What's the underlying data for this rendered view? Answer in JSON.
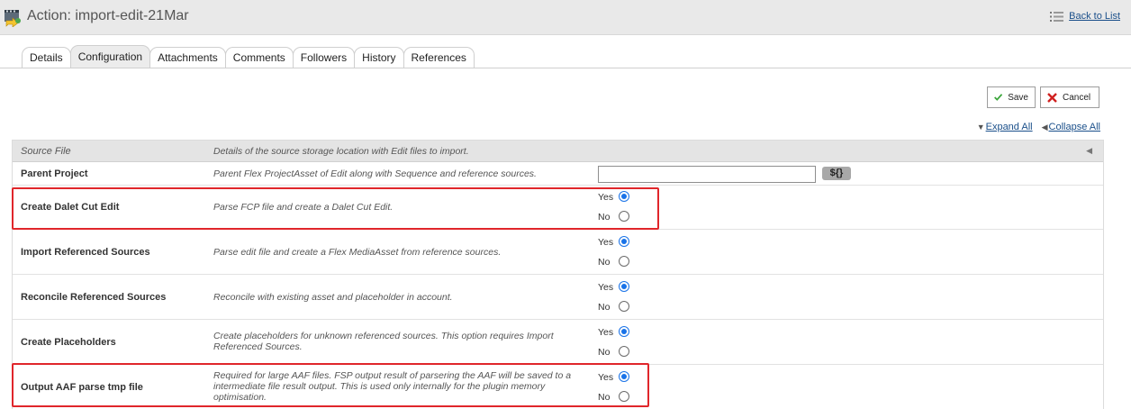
{
  "header": {
    "title": "Action: import-edit-21Mar",
    "back_label": "Back to List"
  },
  "tabs": [
    {
      "label": "Details"
    },
    {
      "label": "Configuration",
      "active": true
    },
    {
      "label": "Attachments"
    },
    {
      "label": "Comments"
    },
    {
      "label": "Followers"
    },
    {
      "label": "History"
    },
    {
      "label": "References"
    }
  ],
  "toolbar": {
    "save_label": "Save",
    "cancel_label": "Cancel"
  },
  "links": {
    "expand_all": "Expand All",
    "collapse_all": "Collapse All"
  },
  "section": {
    "label": "Source File",
    "description": "Details of the source storage location with Edit files to import."
  },
  "rows": {
    "parent_project": {
      "label": "Parent Project",
      "description": "Parent Flex ProjectAsset of Edit along with Sequence and reference sources.",
      "value": "",
      "var_button": "${}"
    },
    "create_dalet": {
      "label": "Create Dalet Cut Edit",
      "description": "Parse FCP file and create a Dalet Cut Edit.",
      "yes": "Yes",
      "no": "No",
      "selected": "Yes"
    },
    "import_sources": {
      "label": "Import Referenced Sources",
      "description": "Parse edit file and create a Flex MediaAsset from reference sources.",
      "yes": "Yes",
      "no": "No",
      "selected": "Yes"
    },
    "reconcile": {
      "label": "Reconcile Referenced Sources",
      "description": "Reconcile with existing asset and placeholder in account.",
      "yes": "Yes",
      "no": "No",
      "selected": "Yes"
    },
    "placeholders": {
      "label": "Create Placeholders",
      "description": "Create placeholders for unknown referenced sources. This option requires Import Referenced Sources.",
      "yes": "Yes",
      "no": "No",
      "selected": "Yes"
    },
    "output_aaf": {
      "label": "Output AAF parse tmp file",
      "description": "Required for large AAF files. FSP output result of parsering the AAF will be saved to a intermediate file result output. This is used only internally for the plugin memory optimisation.",
      "yes": "Yes",
      "no": "No",
      "selected": "Yes"
    }
  },
  "colors": {
    "accent": "#1a73e8",
    "highlight": "#e0262b",
    "link": "#1a4f8a"
  }
}
